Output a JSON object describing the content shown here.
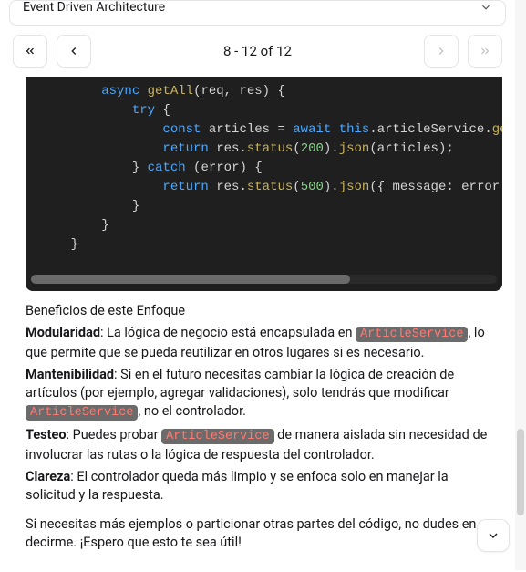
{
  "dropdown": {
    "label": "Event Driven Architecture"
  },
  "pager": {
    "range": "8 - 12 of 12"
  },
  "code": {
    "lines": [
      {
        "indent": 3,
        "tokens": [
          [
            "kw",
            "async"
          ],
          [
            "pl",
            " "
          ],
          [
            "fn",
            "getAll"
          ],
          [
            "pl",
            "(req, res) {"
          ]
        ]
      },
      {
        "indent": 4,
        "tokens": [
          [
            "kw",
            "try"
          ],
          [
            "pl",
            " {"
          ]
        ]
      },
      {
        "indent": 5,
        "tokens": [
          [
            "kw",
            "const"
          ],
          [
            "pl",
            " articles "
          ],
          [
            "pl",
            "="
          ],
          [
            "pl",
            " "
          ],
          [
            "kw",
            "await"
          ],
          [
            "pl",
            " "
          ],
          [
            "kw",
            "this"
          ],
          [
            "pl",
            "."
          ],
          [
            "pl",
            "articleService"
          ],
          [
            "pl",
            "."
          ],
          [
            "fn",
            "ge"
          ]
        ]
      },
      {
        "indent": 5,
        "tokens": [
          [
            "kw",
            "return"
          ],
          [
            "pl",
            " res."
          ],
          [
            "fn",
            "status"
          ],
          [
            "pl",
            "("
          ],
          [
            "num",
            "200"
          ],
          [
            "pl",
            ")."
          ],
          [
            "fn",
            "json"
          ],
          [
            "pl",
            "(articles);"
          ]
        ]
      },
      {
        "indent": 4,
        "tokens": [
          [
            "pl",
            "} "
          ],
          [
            "kw",
            "catch"
          ],
          [
            "pl",
            " (error) {"
          ]
        ]
      },
      {
        "indent": 5,
        "tokens": [
          [
            "kw",
            "return"
          ],
          [
            "pl",
            " res."
          ],
          [
            "fn",
            "status"
          ],
          [
            "pl",
            "("
          ],
          [
            "num",
            "500"
          ],
          [
            "pl",
            ")."
          ],
          [
            "fn",
            "json"
          ],
          [
            "pl",
            "({ message"
          ],
          [
            "pl",
            ":"
          ],
          [
            "pl",
            " error."
          ]
        ]
      },
      {
        "indent": 4,
        "tokens": [
          [
            "pl",
            "}"
          ]
        ]
      },
      {
        "indent": 3,
        "tokens": [
          [
            "pl",
            "}"
          ]
        ]
      },
      {
        "indent": 2,
        "tokens": [
          [
            "pl",
            "}"
          ]
        ]
      }
    ]
  },
  "benefits": {
    "title": "Beneficios de este Enfoque",
    "items": [
      {
        "label": "Modularidad",
        "pre": ": La lógica de negocio está encapsulada en ",
        "code": "ArticleService",
        "post": ", lo que permite que se pueda reutilizar en otros lugares si es necesario."
      },
      {
        "label": "Mantenibilidad",
        "pre": ": Si en el futuro necesitas cambiar la lógica de creación de artículos (por ejemplo, agregar validaciones), solo tendrás que modificar ",
        "code": "ArticleService",
        "post": ", no el controlador."
      },
      {
        "label": "Testeo",
        "pre": ": Puedes probar ",
        "code": "ArticleService",
        "post": " de manera aislada sin necesidad de involucrar las rutas o la lógica de respuesta del controlador."
      },
      {
        "label": "Clareza",
        "pre": ": El controlador queda más limpio y se enfoca solo en manejar la solicitud y la respuesta.",
        "code": "",
        "post": ""
      }
    ],
    "closing": "Si necesitas más ejemplos o particionar otras partes del código, no dudes en decirme. ¡Espero que esto te sea útil!"
  }
}
